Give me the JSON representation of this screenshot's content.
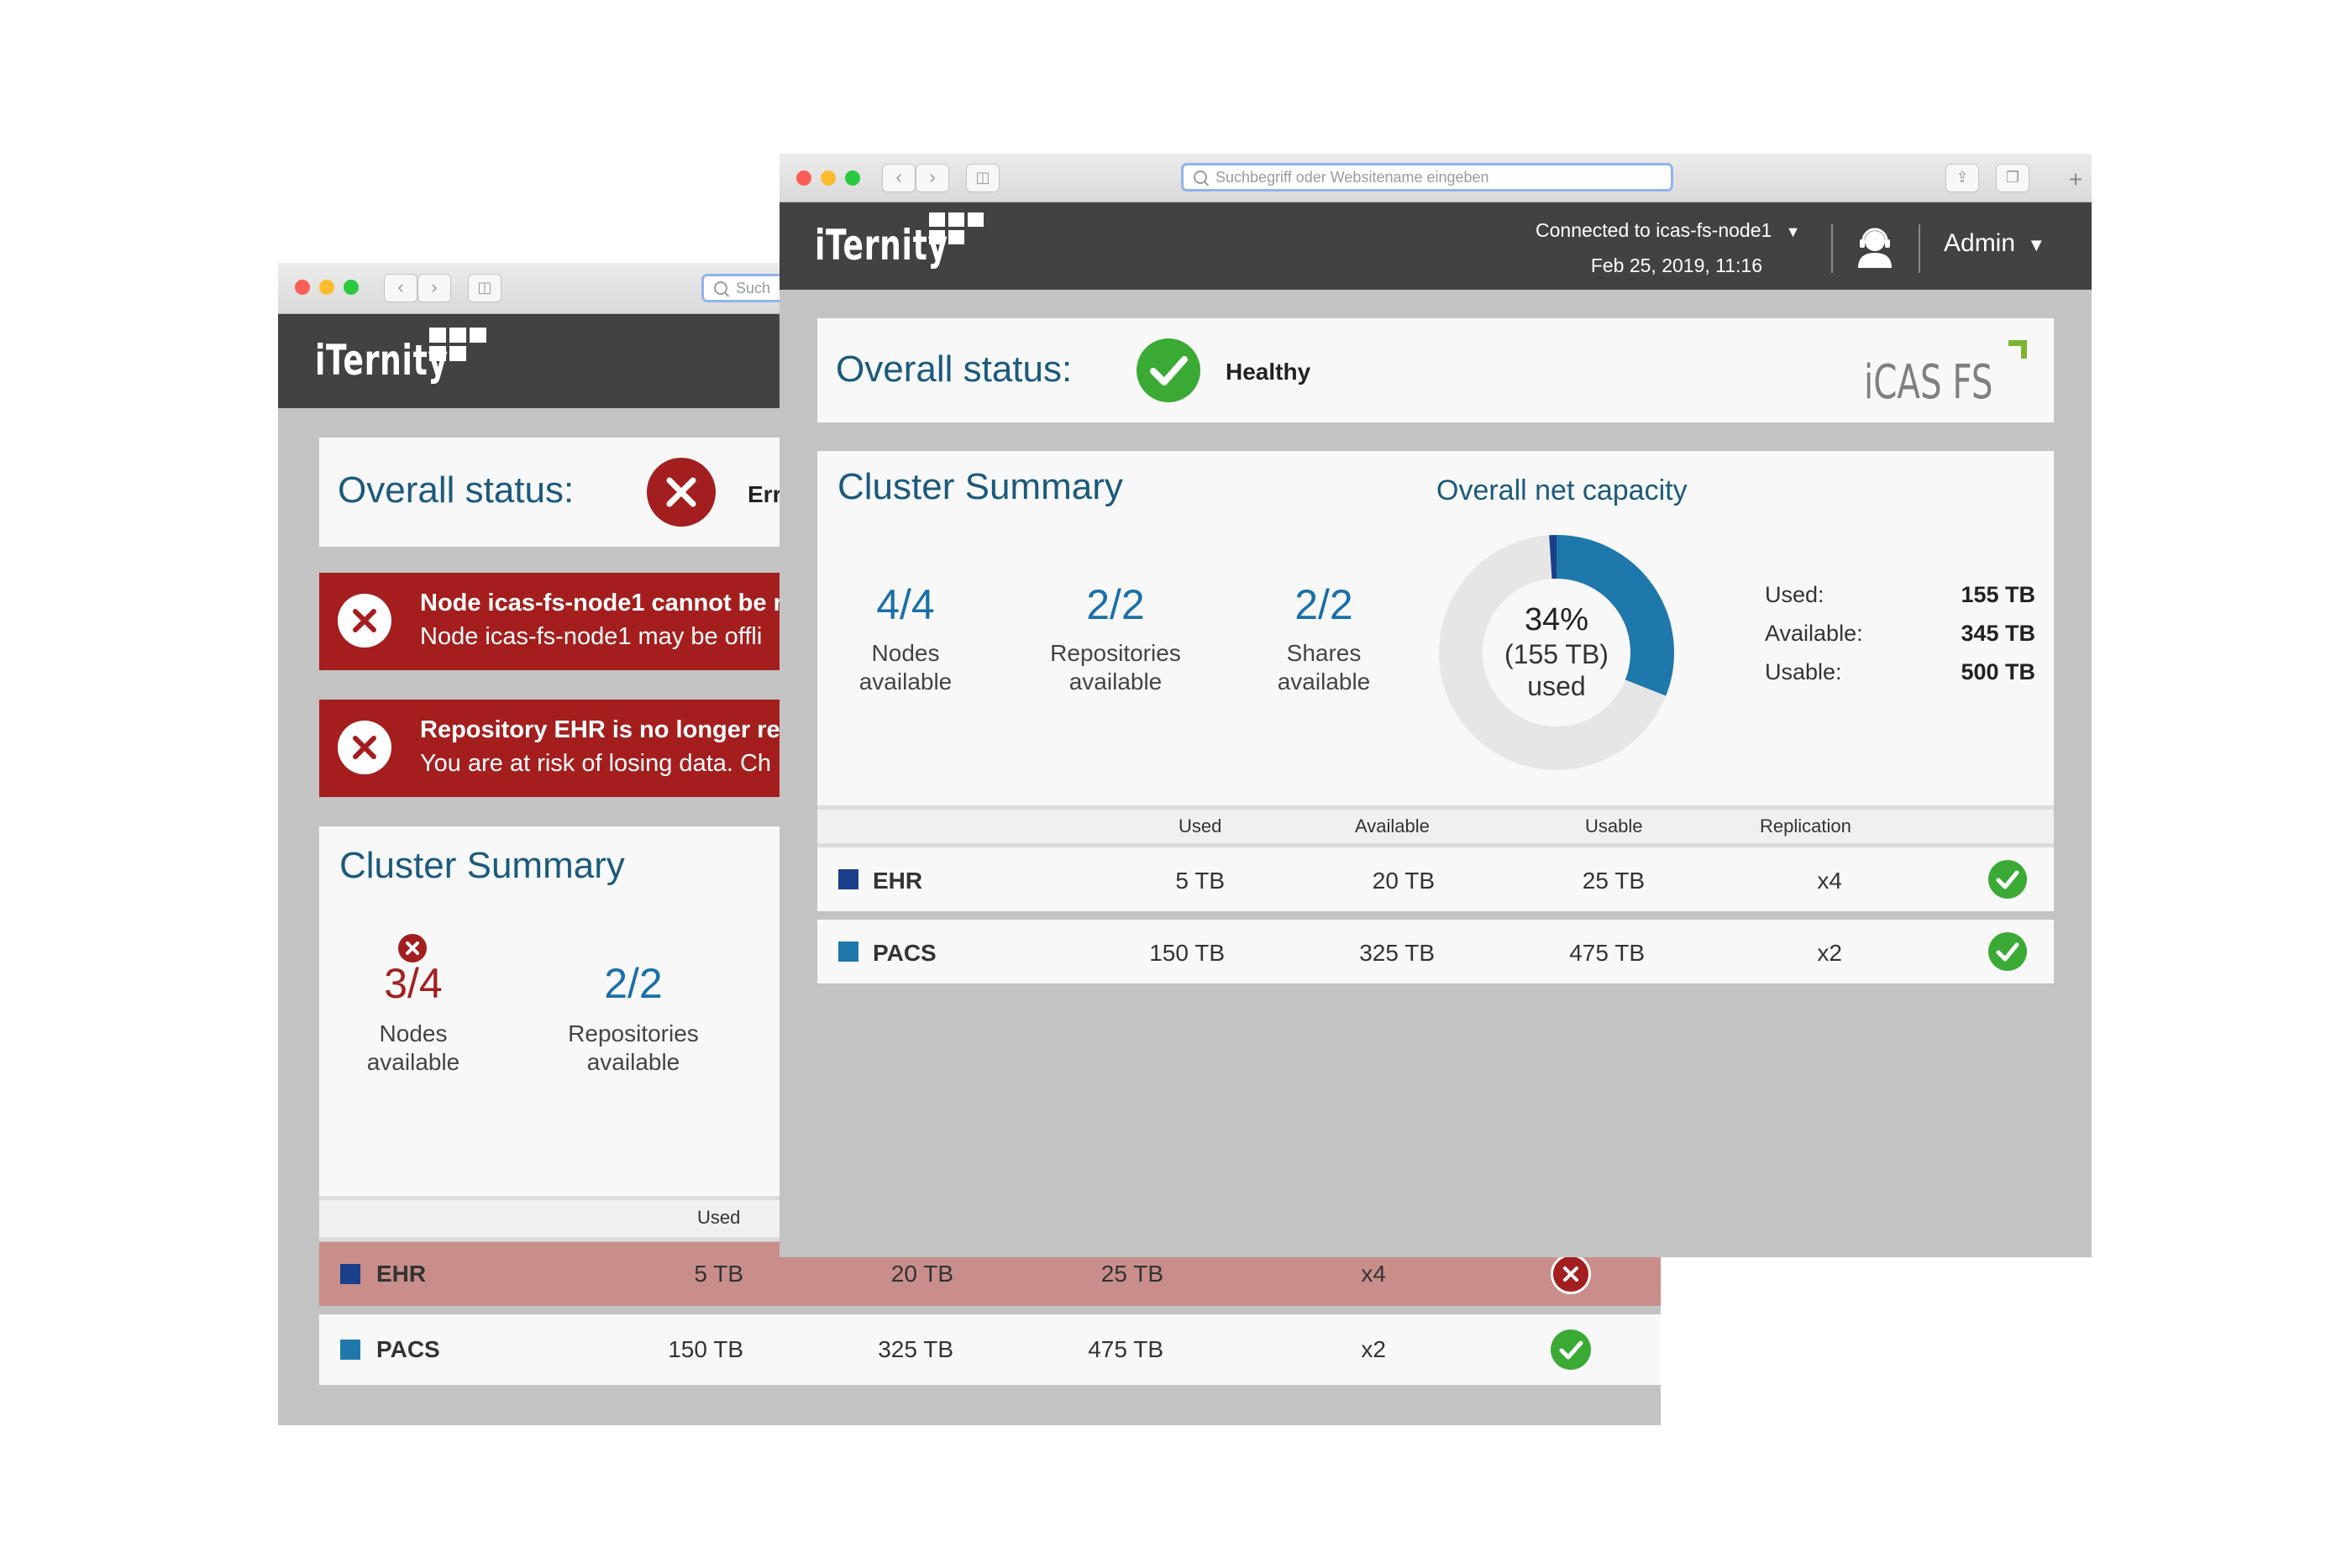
{
  "back_window": {
    "url_placeholder": "Such",
    "logo_text": "iTernity",
    "overall_status": {
      "label": "Overall status:",
      "value": "Err"
    },
    "errors": [
      {
        "title": "Node icas-fs-node1 cannot be r",
        "detail": "Node icas-fs-node1 may be offli"
      },
      {
        "title": "Repository EHR is no longer rep",
        "detail": "You are at risk of losing data. Ch"
      }
    ],
    "cluster_summary": {
      "title": "Cluster Summary",
      "stats": [
        {
          "value": "3/4",
          "label_line1": "Nodes",
          "label_line2": "available"
        },
        {
          "value": "2/2",
          "label_line1": "Repositories",
          "label_line2": "available"
        }
      ]
    },
    "table": {
      "col_used": "Used",
      "rows": [
        {
          "name": "EHR",
          "used": "5 TB",
          "available": "20 TB",
          "usable": "25 TB",
          "replication": "x4",
          "status": "error",
          "color": "#1c3f8c"
        },
        {
          "name": "PACS",
          "used": "150 TB",
          "available": "325 TB",
          "usable": "475 TB",
          "replication": "x2",
          "status": "ok",
          "color": "#1e78ab"
        }
      ]
    }
  },
  "front_window": {
    "url_placeholder": "Suchbegriff oder Websitename eingeben",
    "logo_text": "iTernity",
    "header": {
      "connection": "Connected to icas-fs-node1",
      "datetime": "Feb 25, 2019, 11:16",
      "user": "Admin"
    },
    "overall_status": {
      "label": "Overall status:",
      "value": "Healthy",
      "product_logo": "iCAS FS"
    },
    "cluster_summary": {
      "title": "Cluster Summary",
      "stats": [
        {
          "value": "4/4",
          "label_line1": "Nodes",
          "label_line2": "available"
        },
        {
          "value": "2/2",
          "label_line1": "Repositories",
          "label_line2": "available"
        },
        {
          "value": "2/2",
          "label_line1": "Shares",
          "label_line2": "available"
        }
      ]
    },
    "capacity": {
      "title": "Overall net capacity",
      "percent_label": "34%",
      "amount_label": "(155 TB)",
      "used_word": "used",
      "used_fraction": 0.31,
      "ehr_fraction": 0.01,
      "colors": {
        "used": "#1e78ab",
        "ehr": "#1c3f8c",
        "track": "#e6e6e6"
      },
      "legend": [
        {
          "label": "Used:",
          "value": "155 TB"
        },
        {
          "label": "Available:",
          "value": "345 TB"
        },
        {
          "label": "Usable:",
          "value": "500 TB"
        }
      ]
    },
    "table": {
      "columns": {
        "used": "Used",
        "available": "Available",
        "usable": "Usable",
        "replication": "Replication"
      },
      "rows": [
        {
          "name": "EHR",
          "used": "5 TB",
          "available": "20 TB",
          "usable": "25 TB",
          "replication": "x4",
          "status": "ok",
          "color": "#1c3f8c"
        },
        {
          "name": "PACS",
          "used": "150 TB",
          "available": "325 TB",
          "usable": "475 TB",
          "replication": "x2",
          "status": "ok",
          "color": "#1e78ab"
        }
      ]
    }
  }
}
